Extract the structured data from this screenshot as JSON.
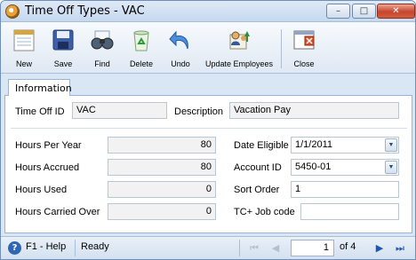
{
  "window": {
    "title": "Time Off Types - VAC",
    "minimize": "–",
    "restore": "□",
    "close": "✕"
  },
  "toolbar": [
    {
      "label": "New",
      "icon": "new-document-icon"
    },
    {
      "label": "Save",
      "icon": "floppy-disk-icon"
    },
    {
      "label": "Find",
      "icon": "binoculars-icon"
    },
    {
      "label": "Delete",
      "icon": "recycle-bin-icon"
    },
    {
      "label": "Undo",
      "icon": "undo-arrow-icon"
    },
    {
      "label": "Update Employees",
      "icon": "update-employees-icon"
    },
    {
      "label": "Close",
      "icon": "close-window-icon"
    }
  ],
  "tab": {
    "label": "Information"
  },
  "form": {
    "time_off_id_label": "Time Off ID",
    "time_off_id": "VAC",
    "description_label": "Description",
    "description": "Vacation Pay",
    "hours_per_year_label": "Hours Per Year",
    "hours_per_year": "80",
    "hours_accrued_label": "Hours Accrued",
    "hours_accrued": "80",
    "hours_used_label": "Hours Used",
    "hours_used": "0",
    "hours_carried_over_label": "Hours Carried Over",
    "hours_carried_over": "0",
    "date_eligible_label": "Date Eligible",
    "date_eligible": "1/1/2011",
    "account_id_label": "Account ID",
    "account_id": "5450-01",
    "sort_order_label": "Sort Order",
    "sort_order": "1",
    "tc_job_code_label": "TC+ Job code",
    "tc_job_code": ""
  },
  "status": {
    "help": "F1 - Help",
    "state": "Ready",
    "page_current": "1",
    "page_of": "of 4"
  }
}
